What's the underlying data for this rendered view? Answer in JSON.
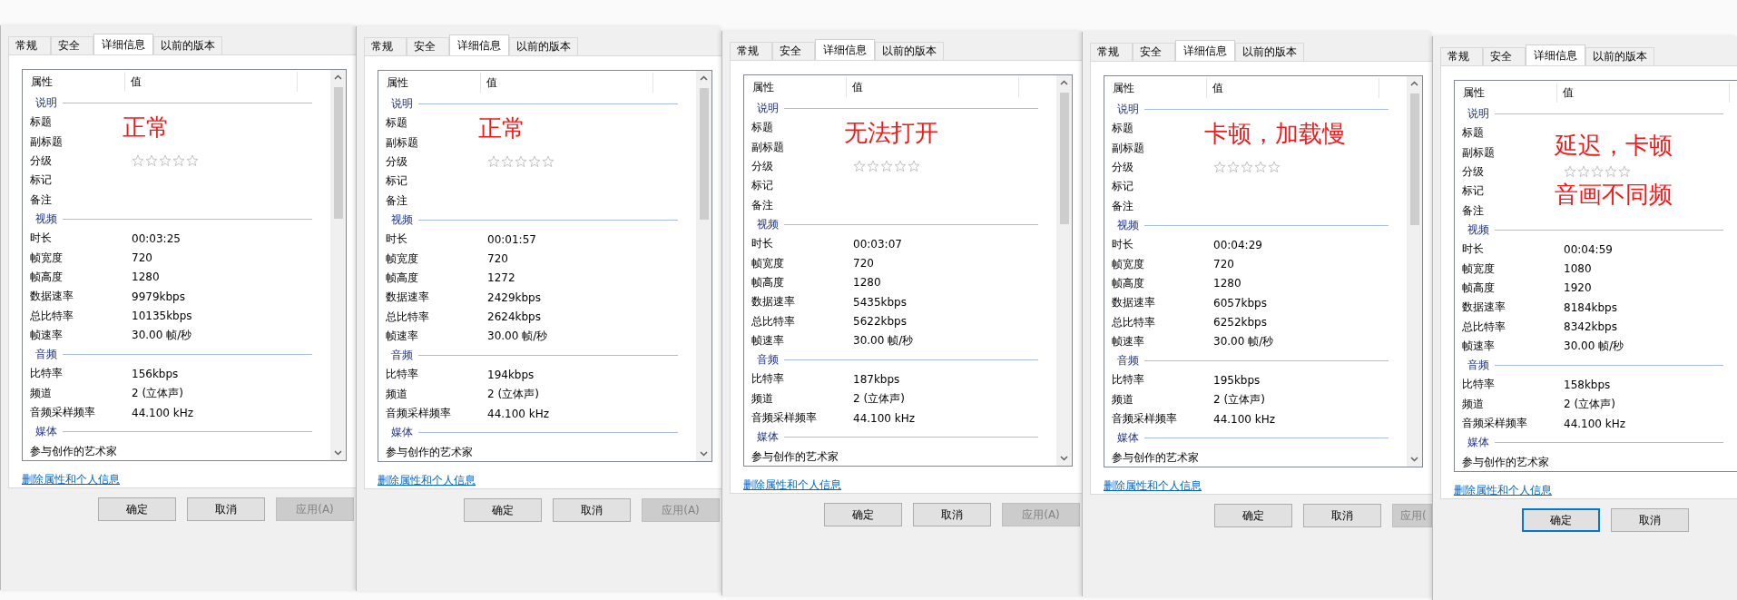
{
  "dialogs": [
    {
      "tabs": [
        {
          "label": "常规",
          "selected": false
        },
        {
          "label": "安全",
          "selected": false
        },
        {
          "label": "详细信息",
          "selected": true
        },
        {
          "label": "以前的版本",
          "selected": false
        }
      ],
      "columns": [
        "属性",
        "值"
      ],
      "annotation": [
        "正常"
      ],
      "scrollbar": true,
      "sections": [
        {
          "title": "说明",
          "rows": [
            {
              "name": "标题"
            },
            {
              "name": "副标题"
            },
            {
              "name": "分级",
              "stars": 0
            },
            {
              "name": "标记"
            },
            {
              "name": "备注"
            }
          ]
        },
        {
          "title": "视频",
          "rows": [
            {
              "name": "时长",
              "value": "00:03:25"
            },
            {
              "name": "帧宽度",
              "value": "720"
            },
            {
              "name": "帧高度",
              "value": "1280"
            },
            {
              "name": "数据速率",
              "value": "9979kbps"
            },
            {
              "name": "总比特率",
              "value": "10135kbps"
            },
            {
              "name": "帧速率",
              "value": "30.00 帧/秒"
            }
          ]
        },
        {
          "title": "音频",
          "rows": [
            {
              "name": "比特率",
              "value": "156kbps"
            },
            {
              "name": "频道",
              "value": "2 (立体声)"
            },
            {
              "name": "音频采样频率",
              "value": "44.100 kHz"
            }
          ]
        },
        {
          "title": "媒体",
          "rows": [
            {
              "name": "参与创作的艺术家"
            }
          ]
        }
      ],
      "link": "删除属性和个人信息",
      "buttons": [
        {
          "label": "确定",
          "disabled": false,
          "focused": false
        },
        {
          "label": "取消",
          "disabled": false,
          "focused": false
        },
        {
          "label": "应用(A)",
          "disabled": true,
          "focused": false
        }
      ]
    },
    {
      "tabs": [
        {
          "label": "常规",
          "selected": false
        },
        {
          "label": "安全",
          "selected": false
        },
        {
          "label": "详细信息",
          "selected": true
        },
        {
          "label": "以前的版本",
          "selected": false
        }
      ],
      "columns": [
        "属性",
        "值"
      ],
      "annotation": [
        "正常"
      ],
      "scrollbar": true,
      "sections": [
        {
          "title": "说明",
          "rows": [
            {
              "name": "标题"
            },
            {
              "name": "副标题"
            },
            {
              "name": "分级",
              "stars": 0
            },
            {
              "name": "标记"
            },
            {
              "name": "备注"
            }
          ]
        },
        {
          "title": "视频",
          "rows": [
            {
              "name": "时长",
              "value": "00:01:57"
            },
            {
              "name": "帧宽度",
              "value": "720"
            },
            {
              "name": "帧高度",
              "value": "1272"
            },
            {
              "name": "数据速率",
              "value": "2429kbps"
            },
            {
              "name": "总比特率",
              "value": "2624kbps"
            },
            {
              "name": "帧速率",
              "value": "30.00 帧/秒"
            }
          ]
        },
        {
          "title": "音频",
          "rows": [
            {
              "name": "比特率",
              "value": "194kbps"
            },
            {
              "name": "频道",
              "value": "2 (立体声)"
            },
            {
              "name": "音频采样频率",
              "value": "44.100 kHz"
            }
          ]
        },
        {
          "title": "媒体",
          "rows": [
            {
              "name": "参与创作的艺术家"
            }
          ]
        }
      ],
      "link": "删除属性和个人信息",
      "buttons": [
        {
          "label": "确定",
          "disabled": false,
          "focused": false
        },
        {
          "label": "取消",
          "disabled": false,
          "focused": false
        },
        {
          "label": "应用(A)",
          "disabled": true,
          "focused": false
        }
      ]
    },
    {
      "tabs": [
        {
          "label": "常规",
          "selected": false
        },
        {
          "label": "安全",
          "selected": false
        },
        {
          "label": "详细信息",
          "selected": true
        },
        {
          "label": "以前的版本",
          "selected": false
        }
      ],
      "columns": [
        "属性",
        "值"
      ],
      "annotation": [
        "无法打开"
      ],
      "scrollbar": true,
      "sections": [
        {
          "title": "说明",
          "rows": [
            {
              "name": "标题"
            },
            {
              "name": "副标题"
            },
            {
              "name": "分级",
              "stars": 0
            },
            {
              "name": "标记"
            },
            {
              "name": "备注"
            }
          ]
        },
        {
          "title": "视频",
          "rows": [
            {
              "name": "时长",
              "value": "00:03:07"
            },
            {
              "name": "帧宽度",
              "value": "720"
            },
            {
              "name": "帧高度",
              "value": "1280"
            },
            {
              "name": "数据速率",
              "value": "5435kbps"
            },
            {
              "name": "总比特率",
              "value": "5622kbps"
            },
            {
              "name": "帧速率",
              "value": "30.00 帧/秒"
            }
          ]
        },
        {
          "title": "音频",
          "rows": [
            {
              "name": "比特率",
              "value": "187kbps"
            },
            {
              "name": "频道",
              "value": "2 (立体声)"
            },
            {
              "name": "音频采样频率",
              "value": "44.100 kHz"
            }
          ]
        },
        {
          "title": "媒体",
          "rows": [
            {
              "name": "参与创作的艺术家"
            }
          ]
        }
      ],
      "link": "删除属性和个人信息",
      "buttons": [
        {
          "label": "确定",
          "disabled": false,
          "focused": false
        },
        {
          "label": "取消",
          "disabled": false,
          "focused": false
        },
        {
          "label": "应用(A)",
          "disabled": true,
          "focused": false
        }
      ]
    },
    {
      "tabs": [
        {
          "label": "常规",
          "selected": false
        },
        {
          "label": "安全",
          "selected": false
        },
        {
          "label": "详细信息",
          "selected": true
        },
        {
          "label": "以前的版本",
          "selected": false
        }
      ],
      "columns": [
        "属性",
        "值"
      ],
      "annotation": [
        "卡顿，加载慢"
      ],
      "scrollbar": true,
      "sections": [
        {
          "title": "说明",
          "rows": [
            {
              "name": "标题"
            },
            {
              "name": "副标题"
            },
            {
              "name": "分级",
              "stars": 0
            },
            {
              "name": "标记"
            },
            {
              "name": "备注"
            }
          ]
        },
        {
          "title": "视频",
          "rows": [
            {
              "name": "时长",
              "value": "00:04:29"
            },
            {
              "name": "帧宽度",
              "value": "720"
            },
            {
              "name": "帧高度",
              "value": "1280"
            },
            {
              "name": "数据速率",
              "value": "6057kbps"
            },
            {
              "name": "总比特率",
              "value": "6252kbps"
            },
            {
              "name": "帧速率",
              "value": "30.00 帧/秒"
            }
          ]
        },
        {
          "title": "音频",
          "rows": [
            {
              "name": "比特率",
              "value": "195kbps"
            },
            {
              "name": "频道",
              "value": "2 (立体声)"
            },
            {
              "name": "音频采样频率",
              "value": "44.100 kHz"
            }
          ]
        },
        {
          "title": "媒体",
          "rows": [
            {
              "name": "参与创作的艺术家"
            }
          ]
        }
      ],
      "link": "删除属性和个人信息",
      "buttons": [
        {
          "label": "确定",
          "disabled": false,
          "focused": false
        },
        {
          "label": "取消",
          "disabled": false,
          "focused": false
        },
        {
          "label": "应用(",
          "disabled": true,
          "focused": false
        }
      ]
    },
    {
      "tabs": [
        {
          "label": "常规",
          "selected": false
        },
        {
          "label": "安全",
          "selected": false
        },
        {
          "label": "详细信息",
          "selected": true
        },
        {
          "label": "以前的版本",
          "selected": false
        }
      ],
      "columns": [
        "属性",
        "值"
      ],
      "annotation": [
        "延迟，卡顿",
        "音画不同频"
      ],
      "scrollbar": false,
      "sections": [
        {
          "title": "说明",
          "rows": [
            {
              "name": "标题"
            },
            {
              "name": "副标题"
            },
            {
              "name": "分级",
              "stars": 0
            },
            {
              "name": "标记"
            },
            {
              "name": "备注"
            }
          ]
        },
        {
          "title": "视频",
          "rows": [
            {
              "name": "时长",
              "value": "00:04:59"
            },
            {
              "name": "帧宽度",
              "value": "1080"
            },
            {
              "name": "帧高度",
              "value": "1920"
            },
            {
              "name": "数据速率",
              "value": "8184kbps"
            },
            {
              "name": "总比特率",
              "value": "8342kbps"
            },
            {
              "name": "帧速率",
              "value": "30.00 帧/秒"
            }
          ]
        },
        {
          "title": "音频",
          "rows": [
            {
              "name": "比特率",
              "value": "158kbps"
            },
            {
              "name": "频道",
              "value": "2 (立体声)"
            },
            {
              "name": "音频采样频率",
              "value": "44.100 kHz"
            }
          ]
        },
        {
          "title": "媒体",
          "rows": [
            {
              "name": "参与创作的艺术家"
            }
          ]
        }
      ],
      "link": "删除属性和个人信息",
      "buttons": [
        {
          "label": "确定",
          "disabled": false,
          "focused": true
        },
        {
          "label": "取消",
          "disabled": false,
          "focused": false
        }
      ]
    }
  ]
}
